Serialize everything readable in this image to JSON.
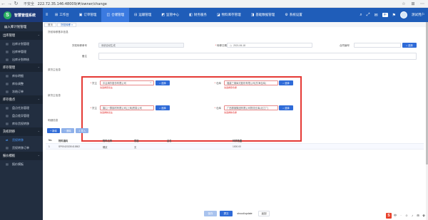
{
  "browser": {
    "back": "←",
    "forward": "→",
    "reload": "↻",
    "insecure_label": "不安全",
    "url": "222.72.35.146:48009/#/owner/change",
    "icons": [
      "☆",
      "⊞",
      "⋯"
    ]
  },
  "topbar": {
    "logo_letter": "S",
    "logo_text": "智慧管理系统",
    "menu_icon": "≡",
    "tabs": [
      {
        "icon": "⊞",
        "label": "工作台"
      },
      {
        "icon": "▣",
        "label": "订单管理"
      },
      {
        "icon": "◫",
        "label": "仓储管理"
      },
      {
        "icon": "⊟",
        "label": "运输管理"
      },
      {
        "icon": "◩",
        "label": "监管中心"
      },
      {
        "icon": "◧",
        "label": "财务服务"
      },
      {
        "icon": "◪",
        "label": "物料库存管理"
      },
      {
        "icon": "◨",
        "label": "基础数据管理"
      },
      {
        "icon": "⚙",
        "label": "系统设置"
      }
    ],
    "active_tab_index": 2,
    "right_icons": [
      "⌕",
      "⤢",
      "✉",
      "中",
      "⚑"
    ],
    "user_name": "测试用户"
  },
  "sidebar": {
    "top_label": "入库计划管理",
    "sections": [
      {
        "title": "出库管理",
        "items": [
          "出库计划管理",
          "出库单管理",
          "出库计划审核"
        ]
      },
      {
        "title": "库存管理",
        "items": [
          "库存明细",
          "库存调整",
          "冻结订单"
        ]
      },
      {
        "title": "库存盘点",
        "items": [
          "盘点任务管理",
          "盘点差异管理",
          "库存货权转移"
        ]
      },
      {
        "title": "货权转移",
        "items": [
          "货权转移",
          "货权转移订单"
        ]
      },
      {
        "title": "报价模板",
        "items": [
          "报价模板"
        ]
      }
    ],
    "active_item": "货权转移"
  },
  "page_tabs": [
    "首页",
    "货权转移 ×"
  ],
  "form": {
    "basic_section": "货权转移基本信息",
    "fields": {
      "doc_no_label": "货权转移单号",
      "doc_no_value": "系统自动生成",
      "date_label": "转移日期",
      "date_value": "2021-06-18",
      "contract_label": "合同编号",
      "contract_value": "",
      "remark_label": "备注",
      "remark_value": ""
    },
    "pick_button": "选择",
    "from_section": "原货主信息",
    "to_section": "新货主信息",
    "from_owner_label": "货主",
    "from_owner_value": "中冶海外股份有限公司",
    "from_owner_error": "请选择原货主",
    "from_warehouse_label": "仓库",
    "from_warehouse_value": "福建三钢闽光股份有限公司(东海仓库)",
    "from_warehouse_error": "请选择原仓库",
    "to_owner_label": "货主",
    "to_owner_value": "唐山一群钢材有限公司(上海)贸易公司",
    "to_owner_error": "请选择新货主",
    "to_warehouse_label": "仓库",
    "to_warehouse_value": "广西柳钢集团有限公司物流仓库(北江厂)",
    "to_warehouse_error": "请选择新仓库"
  },
  "detail": {
    "section": "明细信息",
    "buttons": [
      "新增",
      "删除",
      "导入"
    ],
    "columns": [
      "No.",
      "物料编码",
      "物料名称",
      "规格",
      "品名",
      "转移数量"
    ],
    "rows": [
      [
        "1",
        "SP00420230415802",
        "螺纹",
        "无",
        "",
        "1000.00"
      ]
    ]
  },
  "footer": {
    "buttons": [
      "保存",
      "提交",
      "shoud/update",
      "返回"
    ]
  },
  "tray": {
    "logo": "S",
    "items": [
      "中",
      "·",
      "☺",
      "♪",
      "⊞",
      "✿"
    ]
  },
  "colors": {
    "primary": "#1f5db9",
    "sidebar": "#222e40",
    "error": "#e02020",
    "highlight": "#e53935"
  }
}
